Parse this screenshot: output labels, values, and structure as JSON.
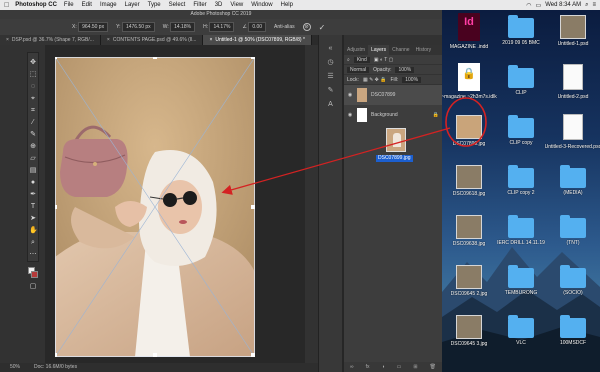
{
  "menubar": {
    "app_name": "Photoshop CC",
    "menus": [
      "File",
      "Edit",
      "Image",
      "Layer",
      "Type",
      "Select",
      "Filter",
      "3D",
      "View",
      "Window",
      "Help"
    ],
    "clock": "Wed 8:34 AM"
  },
  "photoshop": {
    "window_title": "Adobe Photoshop CC 2019",
    "options": {
      "x_label": "X:",
      "x_value": "964.50 px",
      "y_label": "Y:",
      "y_value": "1476.50 px",
      "w_label": "W:",
      "w_value": "14.18%",
      "h_label": "H:",
      "h_value": "14.17%",
      "angle_value": "0.00",
      "antialias_label": "Anti-alias"
    },
    "tabs": [
      {
        "label": "DSP.psd @ 36.7% (Shape 7, RGB/...",
        "active": false
      },
      {
        "label": "CONTENTS PAGE.psd @ 49.6% (Il...",
        "active": false
      },
      {
        "label": "Untitled-1 @ 50% (DSC07899, RGB/8) *",
        "active": true
      }
    ],
    "status": {
      "zoom": "50%",
      "doc": "Doc: 16.6M/0 bytes"
    },
    "layers_panel": {
      "tabs": [
        "Adjustm",
        "Layers",
        "Channe",
        "History"
      ],
      "active_tab": "Layers",
      "filter_label": "Kind",
      "blend_mode": "Normal",
      "opacity_label": "Opacity:",
      "opacity_value": "100%",
      "lock_label": "Lock:",
      "fill_label": "Fill:",
      "fill_value": "100%",
      "layers": [
        {
          "name": "DSC07899",
          "active": true
        },
        {
          "name": "Background",
          "active": false
        }
      ],
      "drag_label": "DSC07899.jpg"
    }
  },
  "desktop": {
    "icons": [
      {
        "label": "MAGAZINE .indd",
        "kind": "indd"
      },
      {
        "label": "2019 09 05 BMC",
        "kind": "folder"
      },
      {
        "label": "Untitled-1.psd",
        "kind": "image"
      },
      {
        "label": "~magazine ~2h3m7s.idlk",
        "kind": "lock"
      },
      {
        "label": "CLIP",
        "kind": "folder"
      },
      {
        "label": "Untitled-2.psd",
        "kind": "doc"
      },
      {
        "label": "DSC07899.jpg",
        "kind": "image"
      },
      {
        "label": "CLIP copy",
        "kind": "folder"
      },
      {
        "label": "Untitled-3-Recovered.psd",
        "kind": "doc"
      },
      {
        "label": "DSC09618.jpg",
        "kind": "image"
      },
      {
        "label": "CLIP copy 2",
        "kind": "folder"
      },
      {
        "label": "(MEDIA)",
        "kind": "folder"
      },
      {
        "label": "DSC09638.jpg",
        "kind": "image"
      },
      {
        "label": "IERC DRILL 14.11.19",
        "kind": "folder"
      },
      {
        "label": "(TNT)",
        "kind": "folder"
      },
      {
        "label": "DSC09645 2.jpg",
        "kind": "image"
      },
      {
        "label": "TEMBURONG",
        "kind": "folder"
      },
      {
        "label": "(SOCIO)",
        "kind": "folder"
      },
      {
        "label": "DSC09645 3.jpg",
        "kind": "image"
      },
      {
        "label": "VLC",
        "kind": "folder"
      },
      {
        "label": "100MSDCF",
        "kind": "folder"
      }
    ]
  },
  "colors": {
    "annotation_red": "#d42222",
    "folder_blue": "#54b0f0",
    "selection_blue": "#1c5fcf"
  }
}
